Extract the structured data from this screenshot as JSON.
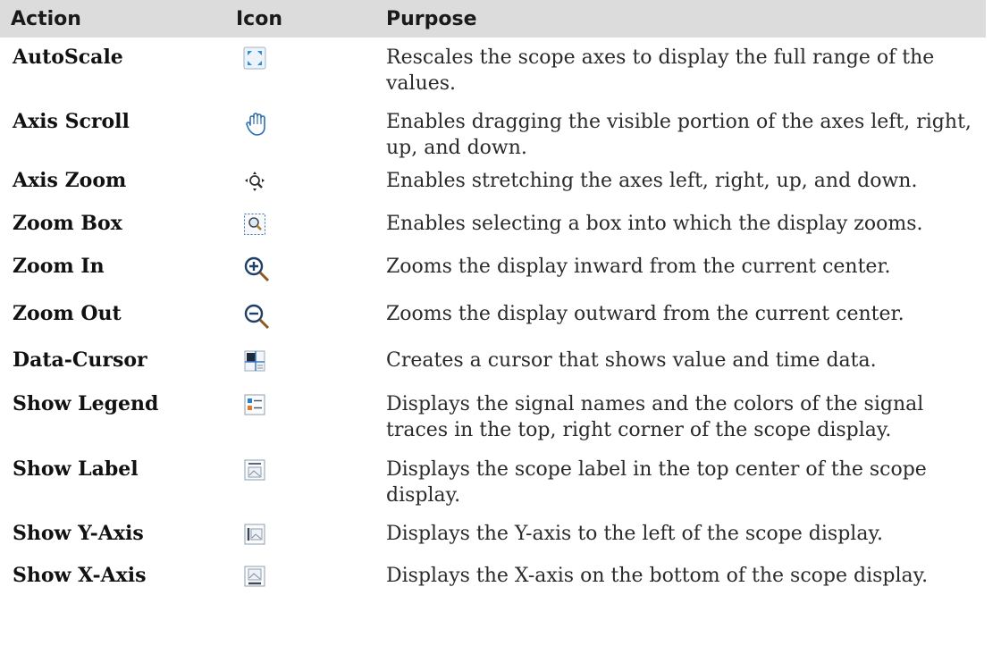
{
  "header": {
    "action": "Action",
    "icon": "Icon",
    "purpose": "Purpose"
  },
  "rows": [
    {
      "action": "AutoScale",
      "icon": "autoscale-icon",
      "purpose": "Rescales the scope axes to display the full range of the values."
    },
    {
      "action": "Axis Scroll",
      "icon": "hand-icon",
      "purpose": "Enables dragging the visible portion of the axes left, right, up, and down."
    },
    {
      "action": "Axis Zoom",
      "icon": "axis-zoom-icon",
      "purpose": "Enables stretching the axes left, right, up, and down."
    },
    {
      "action": "Zoom Box",
      "icon": "zoom-box-icon",
      "purpose": "Enables selecting a box into which the display zooms."
    },
    {
      "action": "Zoom In",
      "icon": "zoom-in-icon",
      "purpose": "Zooms the display inward from the current center."
    },
    {
      "action": "Zoom Out",
      "icon": "zoom-out-icon",
      "purpose": "Zooms the display outward from the current center."
    },
    {
      "action": "Data-Cursor",
      "icon": "data-cursor-icon",
      "purpose": "Creates a cursor that shows value and time data."
    },
    {
      "action": "Show Legend",
      "icon": "legend-icon",
      "purpose": "Displays the signal names and the colors of the signal traces in the top, right corner of the scope display."
    },
    {
      "action": "Show Label",
      "icon": "label-icon",
      "purpose": "Displays the scope label in the top center of the scope display."
    },
    {
      "action": "Show Y-Axis",
      "icon": "y-axis-icon",
      "purpose": "Displays the Y-axis to the left of the scope display."
    },
    {
      "action": "Show X-Axis",
      "icon": "x-axis-icon",
      "purpose": "Displays the X-axis on the bottom of the scope display."
    }
  ]
}
